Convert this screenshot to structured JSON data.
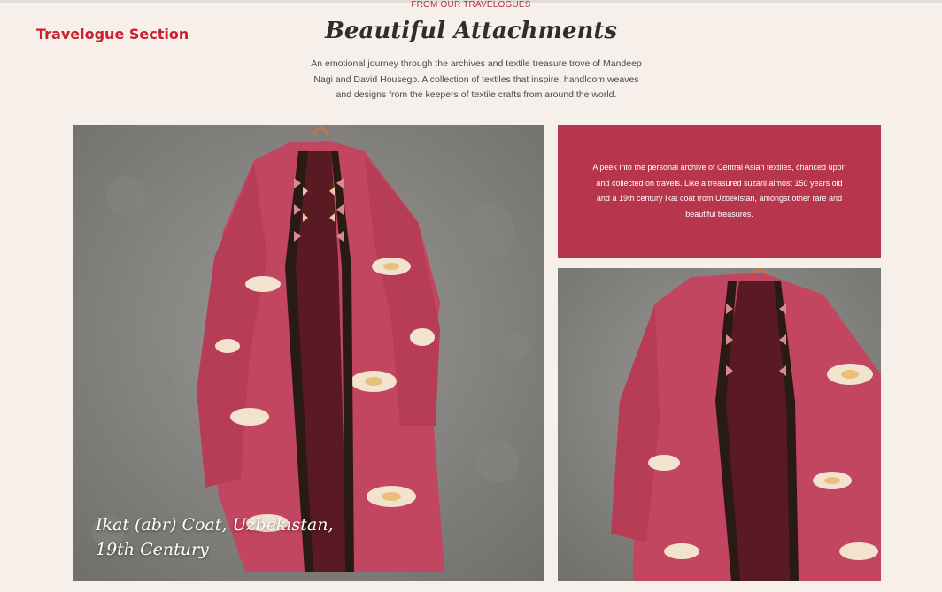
{
  "header": {
    "eyebrow": "FROM OUR TRAVELOGUES",
    "section_label": "Travelogue Section",
    "title": "Beautiful Attachments",
    "intro": "An emotional journey through the archives and textile treasure trove of Mandeep Nagi and David Housego. A collection of textiles that inspire, handloom weaves and designs from the keepers of textile crafts from around the world."
  },
  "feature": {
    "caption": "Ikat (abr) Coat, Uzbekistan, 19th Century",
    "image_subject": "ikat coat on concrete wall"
  },
  "promo": {
    "text": "A peek into the personal archive of Central Asian textiles, chanced upon and collected on travels. Like a treasured suzani almost 150 years old and a 19th century Ikat coat from Uzbekistan, amongst other rare and beautiful treasures."
  },
  "colors": {
    "accent": "#c8202c",
    "promo_bg": "#b7364c",
    "page_bg": "#f7efea",
    "coat_red": "#c24660",
    "coat_cream": "#f2e3cf"
  }
}
